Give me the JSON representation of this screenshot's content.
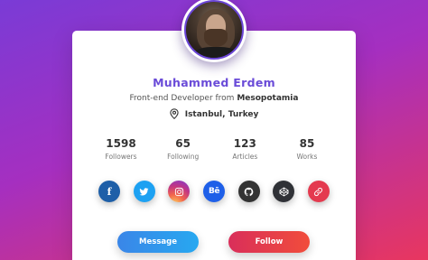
{
  "profile": {
    "name": "Muhammed Erdem",
    "role_prefix": "Front-end Developer from",
    "role_place": "Mesopotamia",
    "location": "Istanbul, Turkey"
  },
  "stats": [
    {
      "value": "1598",
      "label": "Followers"
    },
    {
      "value": "65",
      "label": "Following"
    },
    {
      "value": "123",
      "label": "Articles"
    },
    {
      "value": "85",
      "label": "Works"
    }
  ],
  "socials": [
    {
      "name": "facebook",
      "color": "#1e5fa8",
      "glyph": "f"
    },
    {
      "name": "twitter",
      "color": "#1da1f2"
    },
    {
      "name": "instagram",
      "color": "#c13584"
    },
    {
      "name": "behance",
      "color": "#1e5fe8",
      "glyph": "Bē"
    },
    {
      "name": "github",
      "color": "#333333"
    },
    {
      "name": "codepen",
      "color": "#2f3136"
    },
    {
      "name": "link",
      "color": "#e43a4f"
    }
  ],
  "buttons": {
    "message": "Message",
    "follow": "Follow"
  },
  "colors": {
    "accent": "#6a4bd8",
    "message_btn": "#3a86e8",
    "follow_btn": "#e8365f"
  }
}
